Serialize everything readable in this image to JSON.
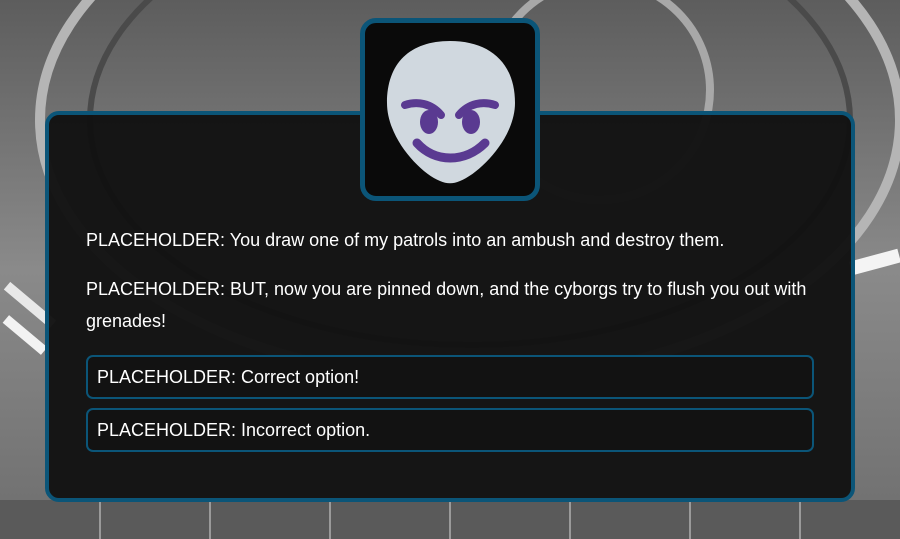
{
  "colors": {
    "panel_border": "#0b5578",
    "panel_bg": "#121212",
    "text": "#ffffff",
    "portrait_face": "#d0d8df",
    "portrait_features": "#5a3a91"
  },
  "portrait": {
    "icon": "smiling-face-with-horns-icon"
  },
  "dialog": {
    "lines": [
      "PLACEHOLDER: You draw one of my patrols into an ambush and destroy them.",
      "PLACEHOLDER: BUT, now you are pinned down, and the cyborgs try to flush you out with grenades!"
    ]
  },
  "options": [
    {
      "label": "PLACEHOLDER: Correct option!"
    },
    {
      "label": "PLACEHOLDER: Incorrect option."
    }
  ]
}
